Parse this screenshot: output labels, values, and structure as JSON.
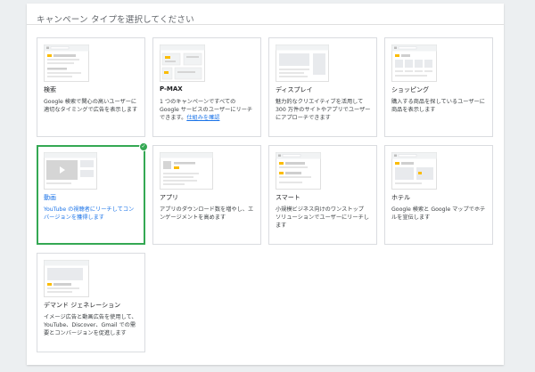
{
  "header": {
    "title": "キャンペーン タイプを選択してください"
  },
  "cards": [
    {
      "name": "search",
      "title": "検索",
      "desc": "Google 検索で関心の高いユーザーに適切なタイミングで広告を表示します"
    },
    {
      "name": "pmax",
      "title": "P-MAX",
      "desc_pre": "1 つのキャンペーンですべての Google サービスのユーザーにリーチできます。",
      "desc_link": "仕組みを確認"
    },
    {
      "name": "display",
      "title": "ディスプレイ",
      "desc": "魅力的なクリエイティブを活用して 300 万件のサイトやアプリでユーザーにアプローチできます"
    },
    {
      "name": "shopping",
      "title": "ショッピング",
      "desc": "購入する商品を探しているユーザーに商品を表示します"
    },
    {
      "name": "video",
      "title": "動画",
      "desc": "YouTube の視聴者にリーチしてコンバージョンを獲得します",
      "selected": true
    },
    {
      "name": "app",
      "title": "アプリ",
      "desc": "アプリのダウンロード数を増やし、エンゲージメントを高めます"
    },
    {
      "name": "smart",
      "title": "スマート",
      "desc": "小規模ビジネス向けのワンストップ ソリューションでユーザーにリーチします"
    },
    {
      "name": "hotel",
      "title": "ホテル",
      "desc": "Google 検索と Google マップでホテルを宣伝します"
    },
    {
      "name": "demand-gen",
      "title": "デマンド ジェネレーション",
      "desc": "イメージ広告と動画広告を使用して、YouTube、Discover、Gmail での需要とコンバージョンを促進します"
    }
  ],
  "colors": {
    "selected_border": "#34a853",
    "accent_blue": "#1a73e8",
    "ad_yellow": "#fbbc04"
  }
}
